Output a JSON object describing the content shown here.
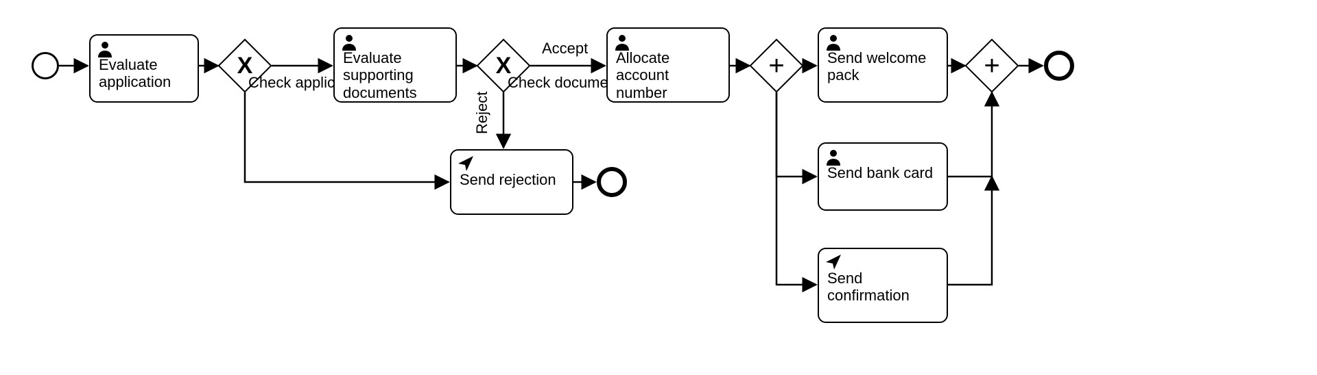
{
  "tasks": {
    "evaluate_app": {
      "label": "Evaluate application",
      "icon": "user"
    },
    "evaluate_docs": {
      "label": "Evaluate supporting documents",
      "icon": "user"
    },
    "send_rejection": {
      "label": "Send rejection",
      "icon": "send"
    },
    "allocate_account": {
      "label": "Allocate account number",
      "icon": "user"
    },
    "send_welcome": {
      "label": "Send welcome pack",
      "icon": "user"
    },
    "send_bank_card": {
      "label": "Send bank card",
      "icon": "user"
    },
    "send_confirmation": {
      "label": "Send confirmation",
      "icon": "send"
    }
  },
  "gateways": {
    "check_app": {
      "label": "Check application",
      "type": "exclusive"
    },
    "check_docs": {
      "label": "Check documents",
      "type": "exclusive"
    },
    "fork": {
      "label": "",
      "type": "parallel"
    },
    "join": {
      "label": "",
      "type": "parallel"
    }
  },
  "edges": {
    "accept": {
      "label": "Accept"
    },
    "reject": {
      "label": "Reject"
    }
  },
  "events": {
    "start": {
      "type": "start"
    },
    "end_reject": {
      "type": "end"
    },
    "end_success": {
      "type": "end"
    }
  }
}
